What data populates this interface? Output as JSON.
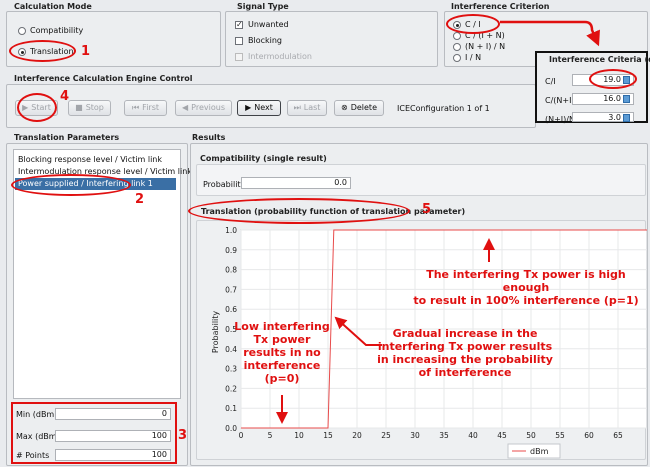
{
  "calc_mode": {
    "title": "Calculation Mode",
    "options": [
      "Compatibility",
      "Translation"
    ],
    "selected": "Translation"
  },
  "signal_type": {
    "title": "Signal Type",
    "options": [
      {
        "label": "Unwanted",
        "checked": true,
        "disabled": false
      },
      {
        "label": "Blocking",
        "checked": false,
        "disabled": false
      },
      {
        "label": "Intermodulation",
        "checked": false,
        "disabled": true
      }
    ]
  },
  "interference_criterion": {
    "title": "Interference Criterion",
    "options": [
      "C / I",
      "C / (I + N)",
      "(N + I) / N",
      "I / N"
    ],
    "selected": "C / I"
  },
  "criteria_popup": {
    "title": "Interference Criteria (dB)",
    "rows": [
      {
        "label": "C/I",
        "value": "19.0"
      },
      {
        "label": "C/(N+I)",
        "value": "16.0"
      },
      {
        "label": "(N+I)/N",
        "value": "3.0"
      }
    ]
  },
  "engine": {
    "title": "Interference Calculation Engine Control",
    "start": "Start",
    "stop": "Stop",
    "first": "First",
    "previous": "Previous",
    "next": "Next",
    "last": "Last",
    "delete": "Delete",
    "config_label": "ICEConfiguration 1 of 1"
  },
  "translation_params": {
    "title": "Translation Parameters",
    "items": [
      "Blocking response level / Victim link",
      "Intermodulation response level / Victim link",
      "Power supplied / Interfering link 1"
    ],
    "selected_index": 2,
    "min_label": "Min (dBm)",
    "min_value": "0",
    "max_label": "Max (dBm)",
    "max_value": "100",
    "points_label": "# Points",
    "points_value": "100"
  },
  "results": {
    "title": "Results",
    "compat_title": "Compatibility (single result)",
    "probability_label": "Probability",
    "probability_value": "0.0",
    "translation_title": "Translation (probability function of translation parameter)"
  },
  "annotations": {
    "n1": "1",
    "n2": "2",
    "n3": "3",
    "n4": "4",
    "n5": "5",
    "high": "The interfering Tx power is high enough\nto result in 100% interference (p=1)",
    "low": "Low interfering\nTx power\nresults in no\ninterference\n(p=0)",
    "gradual": "Gradual increase in the\ninterfering Tx power results\nin increasing the probability\nof interference"
  },
  "chart_data": {
    "type": "line",
    "title": "",
    "xlabel": "",
    "ylabel": "Probability",
    "legend": "dBm",
    "legend_position": "bottom",
    "xlim": [
      0,
      70
    ],
    "ylim": [
      0,
      1.0
    ],
    "x_ticks": [
      0,
      5,
      10,
      15,
      20,
      25,
      30,
      35,
      40,
      45,
      50,
      55,
      60,
      65
    ],
    "y_ticks": [
      0.0,
      0.1,
      0.2,
      0.3,
      0.4,
      0.5,
      0.6,
      0.7,
      0.8,
      0.9,
      1.0
    ],
    "series": [
      {
        "name": "dBm",
        "color": "#e84b4b",
        "x": [
          0,
          15,
          15,
          16,
          70
        ],
        "y": [
          0,
          0,
          0,
          1,
          1
        ]
      }
    ],
    "grid": true
  }
}
